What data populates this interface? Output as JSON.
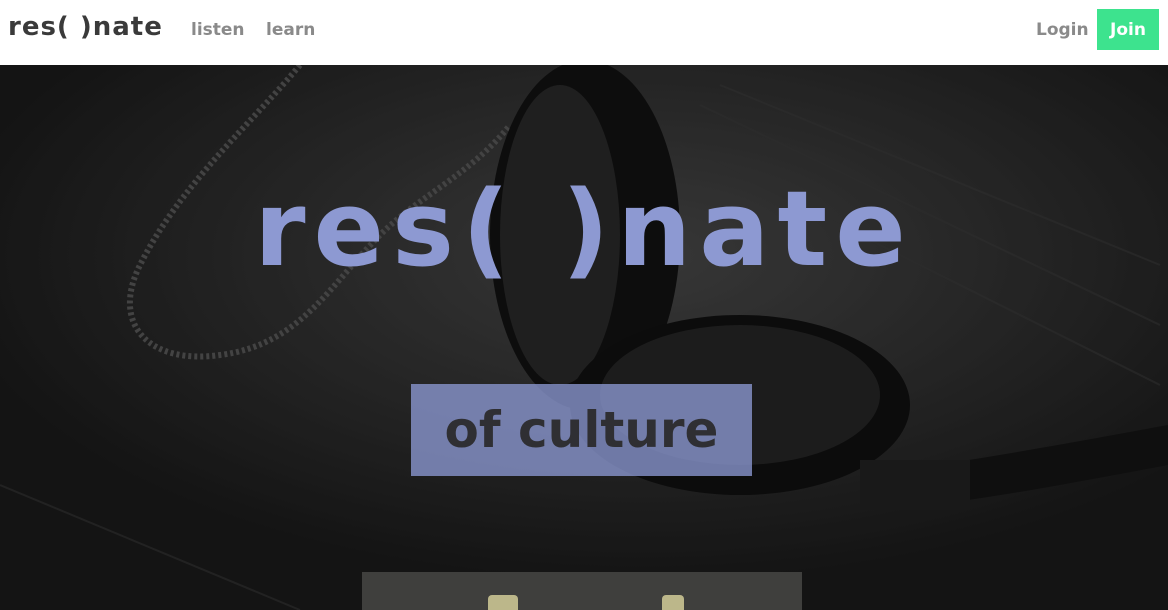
{
  "nav": {
    "brand": "res( )nate",
    "links": [
      "listen",
      "learn"
    ],
    "login": "Login",
    "join": "Join"
  },
  "hero": {
    "title": "res( )nate",
    "tagline": "of culture",
    "colors": {
      "accent": "#8d99d2",
      "join": "#3de38e"
    }
  }
}
